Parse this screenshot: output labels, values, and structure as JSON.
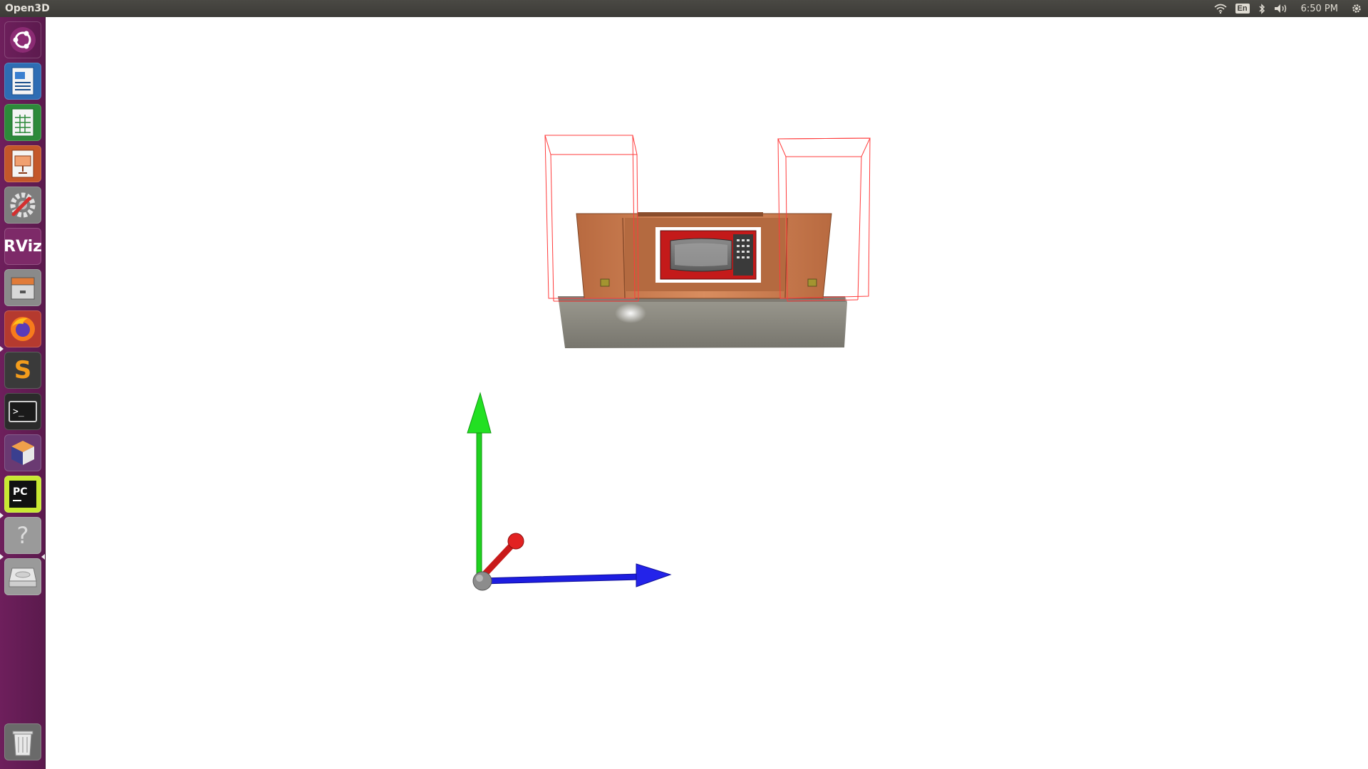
{
  "window": {
    "title": "Open3D"
  },
  "tray": {
    "language": "En",
    "clock": "6:50 PM"
  },
  "launcher": {
    "items": [
      {
        "name": "ubuntu-dash-button",
        "icon": "ubuntu-logo-icon",
        "bg": "#8b2b73"
      },
      {
        "name": "libreoffice-writer-launcher",
        "icon": "writer-document-icon",
        "bg": "#2e6db4"
      },
      {
        "name": "libreoffice-calc-launcher",
        "icon": "calc-spreadsheet-icon",
        "bg": "#2d8a3a"
      },
      {
        "name": "libreoffice-impress-launcher",
        "icon": "impress-presentation-icon",
        "bg": "#c4572a"
      },
      {
        "name": "system-settings-launcher",
        "icon": "settings-wrench-icon",
        "bg": "#7d7d7d"
      },
      {
        "name": "rviz-launcher",
        "icon": "rviz-icon",
        "label": "RViz",
        "bg": "#7d2a68"
      },
      {
        "name": "file-archive-launcher",
        "icon": "file-cabinet-icon",
        "bg": "#8a8a8a"
      },
      {
        "name": "firefox-launcher",
        "icon": "firefox-icon",
        "bg": "#b53a2f"
      },
      {
        "name": "sublime-text-launcher",
        "icon": "sublime-text-icon",
        "label": "S",
        "bg": "#3a3a3a"
      },
      {
        "name": "terminal-launcher",
        "icon": "terminal-icon",
        "label": ">_",
        "bg": "#2b2b2b"
      },
      {
        "name": "virtualbox-launcher",
        "icon": "cube-box-icon",
        "bg": "#6a3a72"
      },
      {
        "name": "pycharm-launcher",
        "icon": "pycharm-icon",
        "label": "PC",
        "bg": "#2b2b2b"
      },
      {
        "name": "unknown-app-launcher",
        "icon": "question-mark-icon",
        "label": "?",
        "bg": "#9a9a9a"
      },
      {
        "name": "disk-drive-launcher",
        "icon": "disk-drive-icon",
        "bg": "#9a9a9a"
      }
    ],
    "trash": {
      "name": "trash-launcher",
      "icon": "trash-can-icon",
      "bg": "#6a6a6a"
    }
  },
  "scene": {
    "colors": {
      "x_axis": "#e02020",
      "y_axis": "#20e020",
      "z_axis": "#2020e6",
      "bbox": "#ff3b3b",
      "cabinet": "#c87a4f",
      "counter": "#8a8880",
      "microwave": "#c41a1a"
    }
  }
}
